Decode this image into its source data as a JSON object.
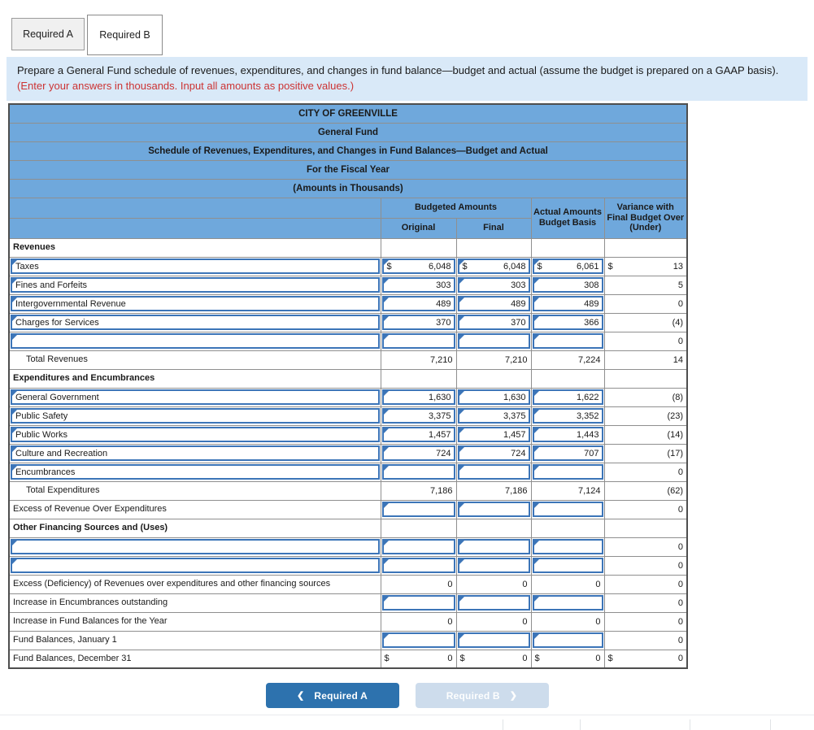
{
  "tabs": [
    {
      "label": "Required A",
      "active": false
    },
    {
      "label": "Required B",
      "active": true
    }
  ],
  "instruction": {
    "text_black": "Prepare a General Fund schedule of revenues, expenditures, and changes in fund balance—budget and actual (assume the budget is prepared on a GAAP basis). ",
    "text_red": "(Enter your answers in thousands. Input all amounts as positive values.)"
  },
  "table": {
    "titles": [
      "CITY OF GREENVILLE",
      "General Fund",
      "Schedule of Revenues, Expenditures, and Changes in Fund Balances—Budget and Actual",
      "For the Fiscal Year",
      "(Amounts in Thousands)"
    ],
    "col_headers": {
      "group": "Budgeted Amounts",
      "sub": [
        "Original",
        "Final"
      ],
      "actual": "Actual Amounts Budget Basis",
      "variance": "Variance with Final Budget Over (Under)"
    },
    "rows": [
      {
        "label": "Revenues",
        "style": "bold",
        "cells": [
          {
            "t": "blank"
          },
          {
            "t": "blank"
          },
          {
            "t": "blank"
          },
          {
            "t": "blank"
          }
        ]
      },
      {
        "label": "Taxes",
        "style": "input",
        "cells": [
          {
            "t": "input",
            "d": "$",
            "v": "6,048"
          },
          {
            "t": "input",
            "d": "$",
            "v": "6,048"
          },
          {
            "t": "input",
            "d": "$",
            "v": "6,061"
          },
          {
            "t": "plain",
            "d": "$",
            "v": "13"
          }
        ]
      },
      {
        "label": "Fines and Forfeits",
        "style": "input",
        "cells": [
          {
            "t": "input",
            "v": "303"
          },
          {
            "t": "input",
            "v": "303"
          },
          {
            "t": "input",
            "v": "308"
          },
          {
            "t": "plain",
            "v": "5"
          }
        ]
      },
      {
        "label": "Intergovernmental Revenue",
        "style": "input",
        "cells": [
          {
            "t": "input",
            "v": "489"
          },
          {
            "t": "input",
            "v": "489"
          },
          {
            "t": "input",
            "v": "489"
          },
          {
            "t": "plain",
            "v": "0"
          }
        ]
      },
      {
        "label": "Charges for Services",
        "style": "input",
        "cells": [
          {
            "t": "input",
            "v": "370"
          },
          {
            "t": "input",
            "v": "370"
          },
          {
            "t": "input",
            "v": "366"
          },
          {
            "t": "plain",
            "v": "(4)"
          }
        ]
      },
      {
        "label": "",
        "style": "input",
        "cells": [
          {
            "t": "input"
          },
          {
            "t": "input"
          },
          {
            "t": "input"
          },
          {
            "t": "plain",
            "v": "0"
          }
        ]
      },
      {
        "label": "Total Revenues",
        "style": "indent",
        "cells": [
          {
            "t": "plain",
            "v": "7,210"
          },
          {
            "t": "plain",
            "v": "7,210"
          },
          {
            "t": "plain",
            "v": "7,224"
          },
          {
            "t": "plain",
            "v": "14"
          }
        ]
      },
      {
        "label": "Expenditures and Encumbrances",
        "style": "bold",
        "cells": [
          {
            "t": "blank"
          },
          {
            "t": "blank"
          },
          {
            "t": "blank"
          },
          {
            "t": "blank"
          }
        ]
      },
      {
        "label": "General Government",
        "style": "input",
        "cells": [
          {
            "t": "input",
            "v": "1,630"
          },
          {
            "t": "input",
            "v": "1,630"
          },
          {
            "t": "input",
            "v": "1,622"
          },
          {
            "t": "plain",
            "v": "(8)"
          }
        ]
      },
      {
        "label": "Public Safety",
        "style": "input",
        "cells": [
          {
            "t": "input",
            "v": "3,375"
          },
          {
            "t": "input",
            "v": "3,375"
          },
          {
            "t": "input",
            "v": "3,352"
          },
          {
            "t": "plain",
            "v": "(23)"
          }
        ]
      },
      {
        "label": "Public Works",
        "style": "input",
        "cells": [
          {
            "t": "input",
            "v": "1,457"
          },
          {
            "t": "input",
            "v": "1,457"
          },
          {
            "t": "input",
            "v": "1,443"
          },
          {
            "t": "plain",
            "v": "(14)"
          }
        ]
      },
      {
        "label": "Culture and Recreation",
        "style": "input",
        "cells": [
          {
            "t": "input",
            "v": "724"
          },
          {
            "t": "input",
            "v": "724"
          },
          {
            "t": "input",
            "v": "707"
          },
          {
            "t": "plain",
            "v": "(17)"
          }
        ]
      },
      {
        "label": "Encumbrances",
        "style": "input",
        "cells": [
          {
            "t": "input"
          },
          {
            "t": "input"
          },
          {
            "t": "input"
          },
          {
            "t": "plain",
            "v": "0"
          }
        ]
      },
      {
        "label": "Total Expenditures",
        "style": "indent",
        "cells": [
          {
            "t": "plain",
            "v": "7,186"
          },
          {
            "t": "plain",
            "v": "7,186"
          },
          {
            "t": "plain",
            "v": "7,124"
          },
          {
            "t": "plain",
            "v": "(62)"
          }
        ]
      },
      {
        "label": "Excess of Revenue Over Expenditures",
        "style": "plain",
        "cells": [
          {
            "t": "input"
          },
          {
            "t": "input"
          },
          {
            "t": "input"
          },
          {
            "t": "plain",
            "v": "0"
          }
        ]
      },
      {
        "label": "Other Financing Sources and (Uses)",
        "style": "bold",
        "cells": [
          {
            "t": "blank"
          },
          {
            "t": "blank"
          },
          {
            "t": "blank"
          },
          {
            "t": "blank"
          }
        ]
      },
      {
        "label": "",
        "style": "input",
        "cells": [
          {
            "t": "input"
          },
          {
            "t": "input"
          },
          {
            "t": "input"
          },
          {
            "t": "plain",
            "v": "0"
          }
        ]
      },
      {
        "label": "",
        "style": "input",
        "cells": [
          {
            "t": "input"
          },
          {
            "t": "input"
          },
          {
            "t": "input"
          },
          {
            "t": "plain",
            "v": "0"
          }
        ]
      },
      {
        "label": "Excess (Deficiency) of Revenues over expenditures and other financing sources",
        "style": "plain",
        "cells": [
          {
            "t": "plain",
            "v": "0"
          },
          {
            "t": "plain",
            "v": "0"
          },
          {
            "t": "plain",
            "v": "0"
          },
          {
            "t": "plain",
            "v": "0"
          }
        ]
      },
      {
        "label": "Increase in Encumbrances outstanding",
        "style": "plain",
        "cells": [
          {
            "t": "input"
          },
          {
            "t": "input"
          },
          {
            "t": "input"
          },
          {
            "t": "plain",
            "v": "0"
          }
        ]
      },
      {
        "label": "Increase in Fund Balances for the Year",
        "style": "plain",
        "cells": [
          {
            "t": "plain",
            "v": "0"
          },
          {
            "t": "plain",
            "v": "0"
          },
          {
            "t": "plain",
            "v": "0"
          },
          {
            "t": "plain",
            "v": "0"
          }
        ]
      },
      {
        "label": "Fund Balances, January 1",
        "style": "plain",
        "cells": [
          {
            "t": "input"
          },
          {
            "t": "input"
          },
          {
            "t": "input"
          },
          {
            "t": "plain",
            "v": "0"
          }
        ]
      },
      {
        "label": "Fund Balances, December 31",
        "style": "plain",
        "cells": [
          {
            "t": "plain",
            "d": "$",
            "v": "0"
          },
          {
            "t": "plain",
            "d": "$",
            "v": "0"
          },
          {
            "t": "plain",
            "d": "$",
            "v": "0"
          },
          {
            "t": "plain",
            "d": "$",
            "v": "0"
          }
        ]
      }
    ]
  },
  "nav": {
    "prev_label": "Required A",
    "next_label": "Required B"
  },
  "colors": {
    "header_blue": "#6fa8dc",
    "panel_blue": "#d9e9f8",
    "input_border_blue": "#3c75b8",
    "button_blue": "#2d72ae",
    "button_disabled": "#cddcec",
    "note_red": "#cc3333"
  }
}
